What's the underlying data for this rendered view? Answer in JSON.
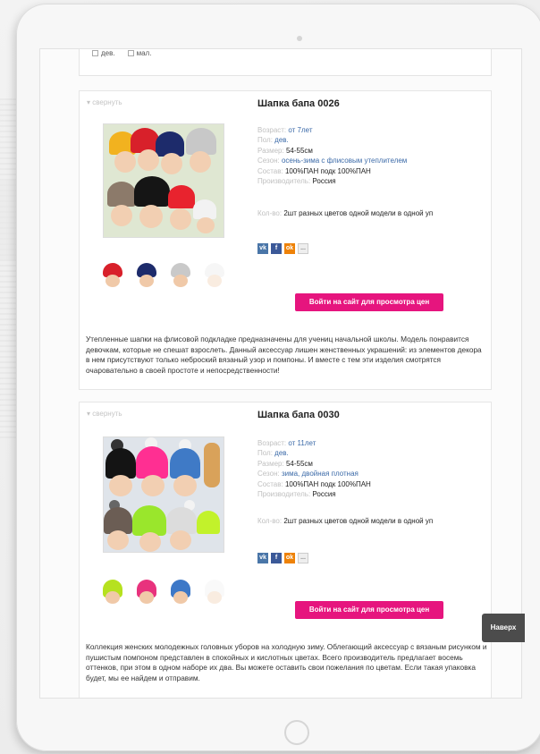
{
  "filter": {
    "gender_options": [
      "дев.",
      "мал."
    ]
  },
  "products": [
    {
      "collapse": "▾ свернуть",
      "title": "Шапка бапа 0026",
      "props": [
        {
          "k": "Возраст:",
          "v": "от 7лет",
          "link": true
        },
        {
          "k": "Пол:",
          "v": "дев.",
          "link": true
        },
        {
          "k": "Размер:",
          "v": "54-55см",
          "link": false
        },
        {
          "k": "Сезон:",
          "v": "осень-зима с флисовым утеплителем",
          "link": true
        },
        {
          "k": "Состав:",
          "v": "100%ПАН подк 100%ПАН",
          "link": false
        },
        {
          "k": "Производитель:",
          "v": "Россия",
          "link": false
        }
      ],
      "qty": {
        "k": "Кол-во:",
        "v": "2шт разных цветов одной модели в одной уп"
      },
      "share": [
        "vk",
        "f",
        "ok",
        "..."
      ],
      "button": "Войти на сайт для просмотра цен",
      "description": "Утепленные шапки на флисовой подкладке предназначены для учениц начальной школы. Модель понравится девочкам, которые не спешат взрослеть. Данный аксессуар лишен женственных украшений: из элементов декора в нем присутствуют только неброский вязаный узор и помпоны. И вместе с тем эти изделия смотрятся очаровательно в своей простоте и непосредственности!",
      "thumb_colors": [
        "#d8202a",
        "#1d2b6b",
        "#c9c9c9",
        "#e8e8e8"
      ]
    },
    {
      "collapse": "▾ свернуть",
      "title": "Шапка бапа 0030",
      "props": [
        {
          "k": "Возраст:",
          "v": "от 11лет",
          "link": true
        },
        {
          "k": "Пол:",
          "v": "дев.",
          "link": true
        },
        {
          "k": "Размер:",
          "v": "54-55см",
          "link": false
        },
        {
          "k": "Сезон:",
          "v": "зима, двойная плотная",
          "link": true
        },
        {
          "k": "Состав:",
          "v": "100%ПАН подк 100%ПАН",
          "link": false
        },
        {
          "k": "Производитель:",
          "v": "Россия",
          "link": false
        }
      ],
      "qty": {
        "k": "Кол-во:",
        "v": "2шт разных цветов одной модели в одной уп"
      },
      "share": [
        "vk",
        "f",
        "ok",
        "..."
      ],
      "button": "Войти на сайт для просмотра цен",
      "description": "Коллекция женских молодежных головных уборов на холодную зиму. Облегающий аксессуар с вязаным рисунком и пушистым помпоном представлен в спокойных и кислотных цветах. Всего производитель предлагает восемь оттенков, при этом в одном наборе их два. Вы можете оставить свои пожелания по цветам. Если такая упаковка будет, мы ее найдем и отправим.",
      "thumb_colors": [
        "#b6e11f",
        "#e8327d",
        "#3d78c7",
        "#eeeeee"
      ]
    }
  ],
  "up_button": "Наверх",
  "colors": {
    "accent": "#e6157e",
    "link": "#3b6aa8",
    "up_bg": "#4c4c4c"
  }
}
